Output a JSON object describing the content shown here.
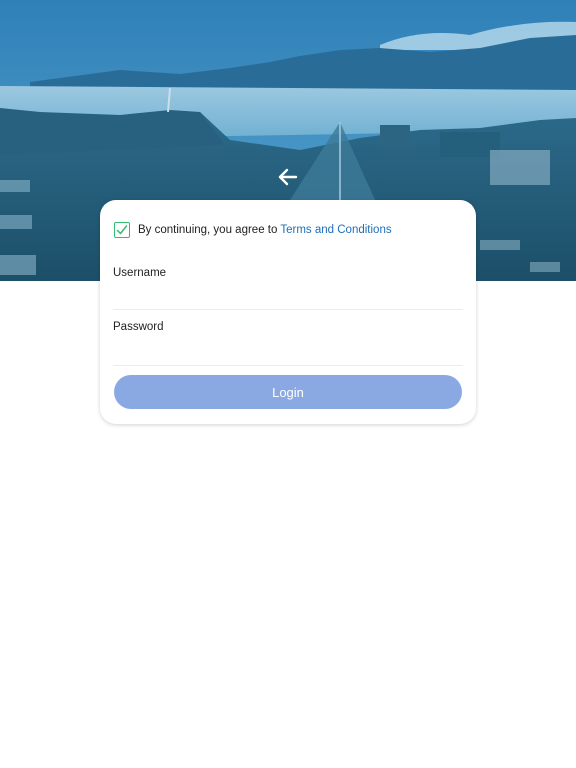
{
  "hero": {
    "image": "mountain-valley-prayer-flags-photo",
    "overlay_color": "#2f7fb5"
  },
  "nav": {
    "back_icon": "arrow-left-icon"
  },
  "terms": {
    "checked": true,
    "text": "By continuing, you agree to",
    "link_label": "Terms and Conditions",
    "check_color": "#2fbf71",
    "link_color": "#1f6fb8"
  },
  "form": {
    "username_label": "Username",
    "username_value": "",
    "password_label": "Password",
    "password_value": "",
    "login_label": "Login",
    "login_color": "#8aa9e3"
  }
}
